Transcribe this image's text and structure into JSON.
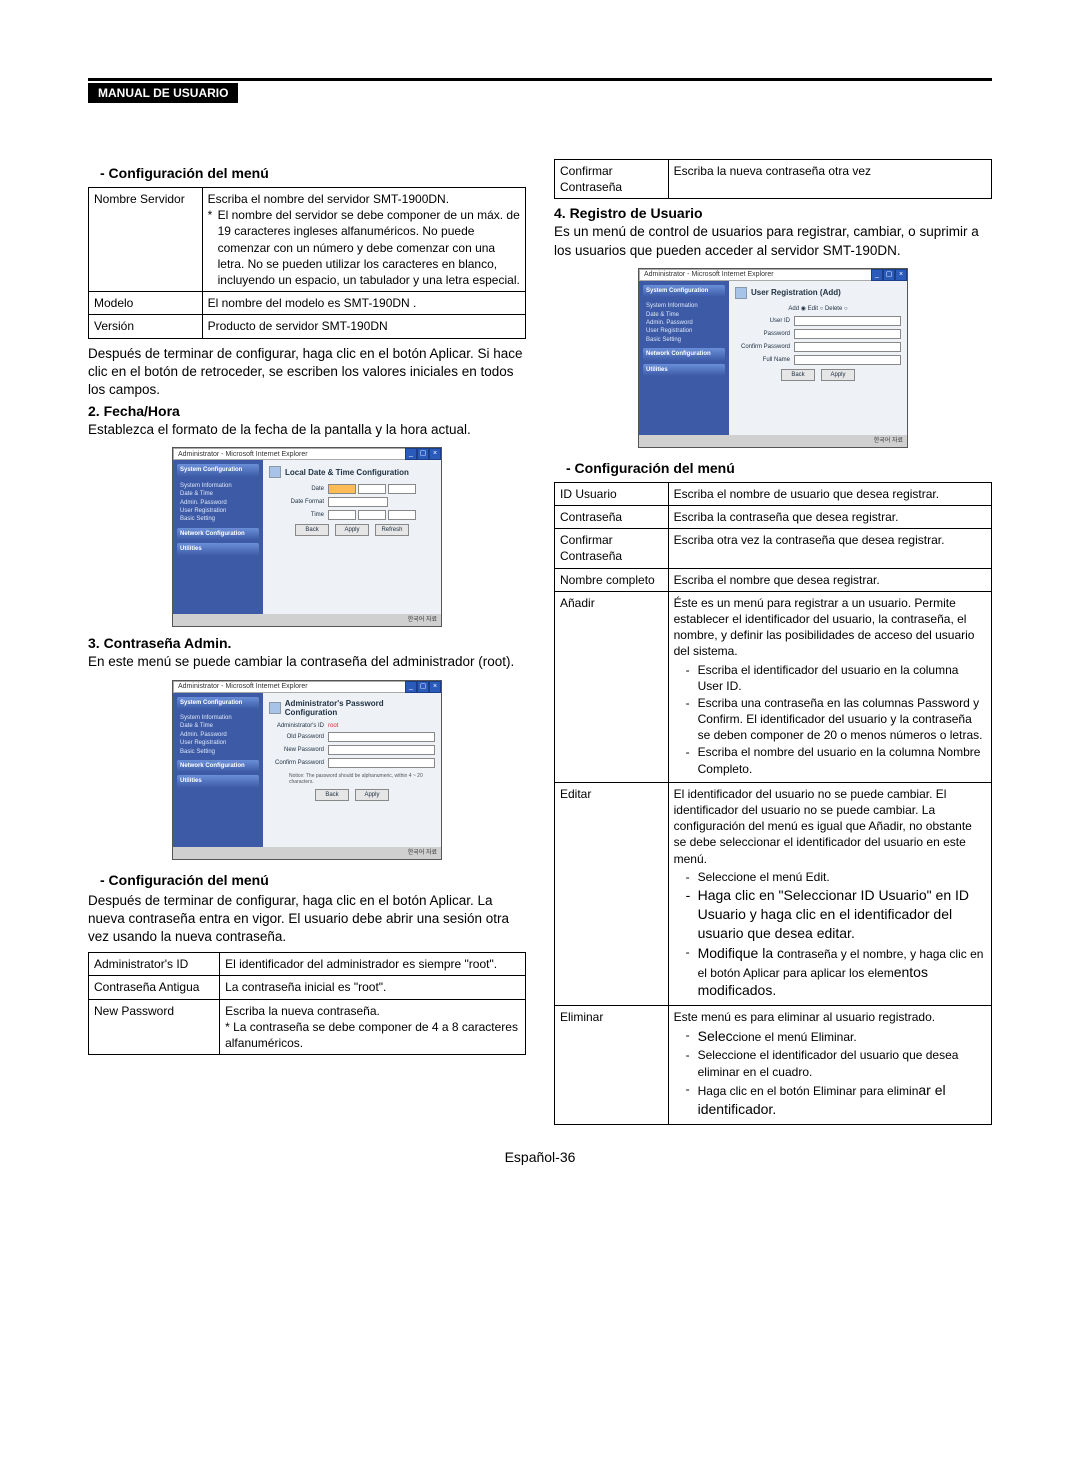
{
  "header": "MANUAL DE USUARIO",
  "left": {
    "menu_config_title": "-  Configuración del menú",
    "table1": {
      "row1_k": "Nombre Servidor",
      "row1_v_line1": "Escriba el nombre del servidor SMT-1900DN.",
      "row1_v_bullet": "El nombre del servidor se debe componer de un máx. de 19 caracteres ingleses alfanuméricos. No puede comenzar con un número y debe comenzar con una letra. No se pueden utilizar los caracteres en blanco, incluyendo un espacio, un tabulador y una letra especial.",
      "row2_k": "Modelo",
      "row2_v": "El nombre del modelo es SMT-190DN .",
      "row3_k": "Versión",
      "row3_v": "Producto de servidor SMT-190DN"
    },
    "para1": "Después de terminar de configurar, haga clic en el botón Aplicar. Si hace clic en el botón de retroceder, se escriben los valores iniciales en todos los campos.",
    "sec2_title": "2. Fecha/Hora",
    "sec2_para": "Establezca el formato de la fecha de la pantalla y la hora actual.",
    "sec3_title": "3. Contraseña Admin.",
    "sec3_para": "En este menú se puede cambiar la contraseña del administrador (root).",
    "menu_config_title2": "-  Configuración del menú",
    "para2": "Después de terminar de configurar, haga clic en el botón Aplicar. La nueva contraseña entra en vigor. El usuario debe abrir una sesión otra vez usando la nueva contraseña.",
    "table2": {
      "r1k": "Administrator's ID",
      "r1v": "El identificador del administrador es siempre \"root\".",
      "r2k": "Contraseña Antigua",
      "r2v": "La contraseña inicial es \"root\".",
      "r3k": "New Password",
      "r3v_l1": "Escriba la nueva contraseña.",
      "r3v_l2": "* La contraseña se debe componer de 4 a 8 caracteres alfanuméricos."
    },
    "ss1": {
      "win": "Administrator - Microsoft Internet Explorer",
      "group1": "System Configuration",
      "side_items1": "System Information\nDate & Time\nAdmin. Password\nUser Registration\nBasic Setting",
      "group2": "Network Configuration",
      "group3": "Utilities",
      "heading": "Local Date & Time Configuration",
      "lbl1": "Date",
      "lbl2": "Date Format",
      "lbl3": "Time",
      "btn1": "Back",
      "btn2": "Apply",
      "btn3": "Refresh",
      "foot": "한국어 자료"
    },
    "ss2": {
      "win": "Administrator - Microsoft Internet Explorer",
      "heading": "Administrator's Password Configuration",
      "lbl1": "Administrator's ID",
      "lbl2": "Old Password",
      "lbl3": "New Password",
      "lbl4": "Confirm Password",
      "note": "Notice: The password should be alphanumeric, within 4 ~ 20 characters.",
      "btn1": "Back",
      "btn2": "Apply",
      "foot": "한국어 자료"
    }
  },
  "right": {
    "table_top": {
      "k": "Confirmar Contraseña",
      "v": "Escriba la nueva contraseña otra vez"
    },
    "sec4_title": "4. Registro de Usuario",
    "sec4_para": "Es un menú de control de usuarios para registrar, cambiar, o suprimir a los usuarios que pueden acceder al servidor SMT-190DN.",
    "menu_config_title": "-  Configuración del menú",
    "table_big": {
      "r1k": "ID Usuario",
      "r1v": "Escriba el nombre de usuario que desea registrar.",
      "r2k": "Contraseña",
      "r2v": "Escriba la contraseña que desea registrar.",
      "r3k": "Confirmar Contraseña",
      "r3v": "Escriba otra vez la contraseña que desea registrar.",
      "r4k": "Nombre completo",
      "r4v": "Escriba el nombre que desea registrar.",
      "r5k": "Añadir",
      "r5v_intro": "Éste es un menú para registrar a un usuario. Permite establecer el identificador del usuario, la contraseña, el nombre, y definir las posibilidades de acceso del usuario del sistema.",
      "r5b1": "Escriba el identificador del usuario en la columna User ID.",
      "r5b2": "Escriba una contraseña en las columnas Password y Confirm. El identificador del usuario y la contraseña se deben componer de 20 o menos números o letras.",
      "r5b3": "Escriba el nombre del usuario en la columna Nombre Completo.",
      "r6k": "Editar",
      "r6v_intro": "El identificador del usuario no se puede cambiar. El identificador del usuario no se puede cambiar. La configuración del menú es igual que Añadir, no obstante se debe seleccionar el identificador del usuario en este menú.",
      "r6b1": "Seleccione el menú Edit.",
      "r6b2": "Haga clic en \"Seleccionar ID Usuario\" en ID Usuario y haga clic en el identificador del usuario que desea editar.",
      "r6b3": "Modifique la contraseña y el nombre, y haga clic en el botón Aplicar para aplicar los elementos modificados.",
      "r7k": "Eliminar",
      "r7v_intro": "Este menú es para eliminar al usuario registrado.",
      "r7b1": "Seleccione el menú Eliminar.",
      "r7b2": "Seleccione el identificador del usuario que desea eliminar en el cuadro.",
      "r7b3": "Haga clic en el botón Eliminar para eliminar el identificador."
    },
    "ss3": {
      "win": "Administrator - Microsoft Internet Explorer",
      "heading": "User Registration (Add)",
      "radios": "Add ◉   Edit ○   Delete ○",
      "lbl1": "User ID",
      "lbl2": "Password",
      "lbl3": "Confirm Password",
      "lbl4": "Full Name",
      "btn1": "Back",
      "btn2": "Apply",
      "foot": "한국어 자료"
    }
  },
  "footer": "Español-36"
}
